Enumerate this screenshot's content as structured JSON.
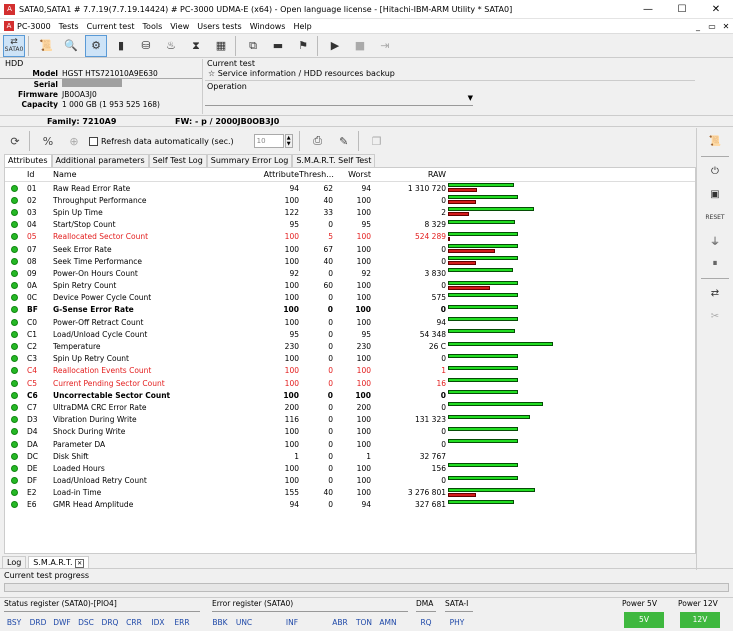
{
  "window": {
    "title": "SATA0,SATA1 # 7.7.19(7.7.19.14424) # PC-3000 UDMA-E (x64) - Open language license - [Hitachi-IBM-ARM Utility * SATA0]"
  },
  "menu": {
    "items": [
      "PC-3000",
      "Tests",
      "Current test",
      "Tools",
      "View",
      "Users tests",
      "Windows",
      "Help"
    ],
    "right": [
      "_",
      "▭",
      "✕"
    ]
  },
  "toolbar": {
    "sata_label": "SATA0"
  },
  "hdd": {
    "header": "HDD",
    "model_label": "Model",
    "model": "HGST HTS721010A9E630",
    "serial_label": "Serial",
    "firmware_label": "Firmware",
    "firmware": "JB0OA3J0",
    "capacity_label": "Capacity",
    "capacity": "1 000 GB (1 953 525 168)"
  },
  "current_test": {
    "label": "Current test",
    "value": "Service information / HDD resources backup",
    "operation_label": "Operation"
  },
  "family": {
    "family": "Family: 7210A9",
    "fw": "FW: - p / 2000JB0OB3J0"
  },
  "refresh": {
    "label": "Refresh data automatically (sec.)",
    "interval": "10"
  },
  "tabs": [
    "Attributes",
    "Additional parameters",
    "Self Test Log",
    "Summary Error Log",
    "S.M.A.R.T. Self Test"
  ],
  "table": {
    "headers": {
      "id": "Id",
      "name": "Name",
      "attribute": "Attribute",
      "threshold": "Thresh...",
      "worst": "Worst",
      "raw": "RAW"
    },
    "rows": [
      {
        "id": "01",
        "name": "Raw Read Error Rate",
        "attr": "94",
        "thr": "62",
        "worst": "94",
        "raw": "1 310 720",
        "style": "",
        "g": 0.63,
        "r": 0.28
      },
      {
        "id": "02",
        "name": "Throughput Performance",
        "attr": "100",
        "thr": "40",
        "worst": "100",
        "raw": "0",
        "style": "",
        "g": 0.67,
        "r": 0.27
      },
      {
        "id": "03",
        "name": "Spin Up Time",
        "attr": "122",
        "thr": "33",
        "worst": "100",
        "raw": "2",
        "style": "",
        "g": 0.82,
        "r": 0.2
      },
      {
        "id": "04",
        "name": "Start/Stop Count",
        "attr": "95",
        "thr": "0",
        "worst": "95",
        "raw": "8 329",
        "style": "",
        "g": 0.64,
        "r": 0
      },
      {
        "id": "05",
        "name": "Reallocated Sector Count",
        "attr": "100",
        "thr": "5",
        "worst": "100",
        "raw": "524 289",
        "style": "red",
        "g": 0.67,
        "r": 0.02
      },
      {
        "id": "07",
        "name": "Seek Error Rate",
        "attr": "100",
        "thr": "67",
        "worst": "100",
        "raw": "0",
        "style": "",
        "g": 0.67,
        "r": 0.45
      },
      {
        "id": "08",
        "name": "Seek Time Performance",
        "attr": "100",
        "thr": "40",
        "worst": "100",
        "raw": "0",
        "style": "",
        "g": 0.67,
        "r": 0.27
      },
      {
        "id": "09",
        "name": "Power-On Hours Count",
        "attr": "92",
        "thr": "0",
        "worst": "92",
        "raw": "3 830",
        "style": "",
        "g": 0.62,
        "r": 0
      },
      {
        "id": "0A",
        "name": "Spin Retry Count",
        "attr": "100",
        "thr": "60",
        "worst": "100",
        "raw": "0",
        "style": "",
        "g": 0.67,
        "r": 0.4
      },
      {
        "id": "0C",
        "name": "Device Power Cycle Count",
        "attr": "100",
        "thr": "0",
        "worst": "100",
        "raw": "575",
        "style": "",
        "g": 0.67,
        "r": 0
      },
      {
        "id": "BF",
        "name": "G-Sense Error Rate",
        "attr": "100",
        "thr": "0",
        "worst": "100",
        "raw": "0",
        "style": "bold",
        "g": 0.67,
        "r": 0
      },
      {
        "id": "C0",
        "name": "Power-Off Retract Count",
        "attr": "100",
        "thr": "0",
        "worst": "100",
        "raw": "94",
        "style": "",
        "g": 0.67,
        "r": 0
      },
      {
        "id": "C1",
        "name": "Load/Unload Cycle Count",
        "attr": "95",
        "thr": "0",
        "worst": "95",
        "raw": "54 348",
        "style": "",
        "g": 0.64,
        "r": 0
      },
      {
        "id": "C2",
        "name": "Temperature",
        "attr": "230",
        "thr": "0",
        "worst": "230",
        "raw": "26 C",
        "style": "",
        "g": 1.0,
        "r": 0
      },
      {
        "id": "C3",
        "name": "Spin Up Retry Count",
        "attr": "100",
        "thr": "0",
        "worst": "100",
        "raw": "0",
        "style": "",
        "g": 0.67,
        "r": 0
      },
      {
        "id": "C4",
        "name": "Reallocation Events Count",
        "attr": "100",
        "thr": "0",
        "worst": "100",
        "raw": "1",
        "style": "red",
        "g": 0.67,
        "r": 0
      },
      {
        "id": "C5",
        "name": "Current Pending Sector Count",
        "attr": "100",
        "thr": "0",
        "worst": "100",
        "raw": "16",
        "style": "red",
        "g": 0.67,
        "r": 0
      },
      {
        "id": "C6",
        "name": "Uncorrectable Sector Count",
        "attr": "100",
        "thr": "0",
        "worst": "100",
        "raw": "0",
        "style": "bold",
        "g": 0.67,
        "r": 0
      },
      {
        "id": "C7",
        "name": "UltraDMA CRC Error Rate",
        "attr": "200",
        "thr": "0",
        "worst": "200",
        "raw": "0",
        "style": "",
        "g": 0.9,
        "r": 0
      },
      {
        "id": "D3",
        "name": "Vibration During Write",
        "attr": "116",
        "thr": "0",
        "worst": "100",
        "raw": "131 323",
        "style": "",
        "g": 0.78,
        "r": 0
      },
      {
        "id": "D4",
        "name": "Shock During Write",
        "attr": "100",
        "thr": "0",
        "worst": "100",
        "raw": "0",
        "style": "",
        "g": 0.67,
        "r": 0
      },
      {
        "id": "DA",
        "name": "Parameter DA",
        "attr": "100",
        "thr": "0",
        "worst": "100",
        "raw": "0",
        "style": "",
        "g": 0.67,
        "r": 0
      },
      {
        "id": "DC",
        "name": "Disk Shift",
        "attr": "1",
        "thr": "0",
        "worst": "1",
        "raw": "32 767",
        "style": "",
        "g": 0.0,
        "r": 0
      },
      {
        "id": "DE",
        "name": "Loaded Hours",
        "attr": "100",
        "thr": "0",
        "worst": "100",
        "raw": "156",
        "style": "",
        "g": 0.67,
        "r": 0
      },
      {
        "id": "DF",
        "name": "Load/Unload Retry Count",
        "attr": "100",
        "thr": "0",
        "worst": "100",
        "raw": "0",
        "style": "",
        "g": 0.67,
        "r": 0
      },
      {
        "id": "E2",
        "name": "Load-in Time",
        "attr": "155",
        "thr": "40",
        "worst": "100",
        "raw": "3 276 801",
        "style": "",
        "g": 0.83,
        "r": 0.27
      },
      {
        "id": "E6",
        "name": "GMR Head Amplitude",
        "attr": "94",
        "thr": "0",
        "worst": "94",
        "raw": "327 681",
        "style": "",
        "g": 0.63,
        "r": 0
      }
    ]
  },
  "bottom_tabs": [
    "Log",
    "S.M.A.R.T."
  ],
  "progress": {
    "label": "Current test progress"
  },
  "status": {
    "status_reg": "Status register (SATA0)-[PIO4]",
    "status_flags": [
      "BSY",
      "DRD",
      "DWF",
      "DSC",
      "DRQ",
      "CRR",
      "IDX",
      "ERR"
    ],
    "error_reg": "Error register (SATA0)",
    "error_flags": [
      "BBK",
      "UNC",
      "",
      "INF",
      "",
      "ABR",
      "TON",
      "AMN"
    ],
    "dma": "DMA",
    "dma_flag": "RQ",
    "sata": "SATA-I",
    "sata_flag": "PHY",
    "p5": "Power 5V",
    "p5v": "5V",
    "p12": "Power 12V",
    "p12v": "12V"
  },
  "colors": {
    "ok_dot": "#25b825",
    "warn_text": "#e31e1e",
    "bar_green": "#22dd22",
    "bar_red": "#d31c1c",
    "flag_text": "#1e48a8",
    "power_ok": "#3fb83f"
  }
}
